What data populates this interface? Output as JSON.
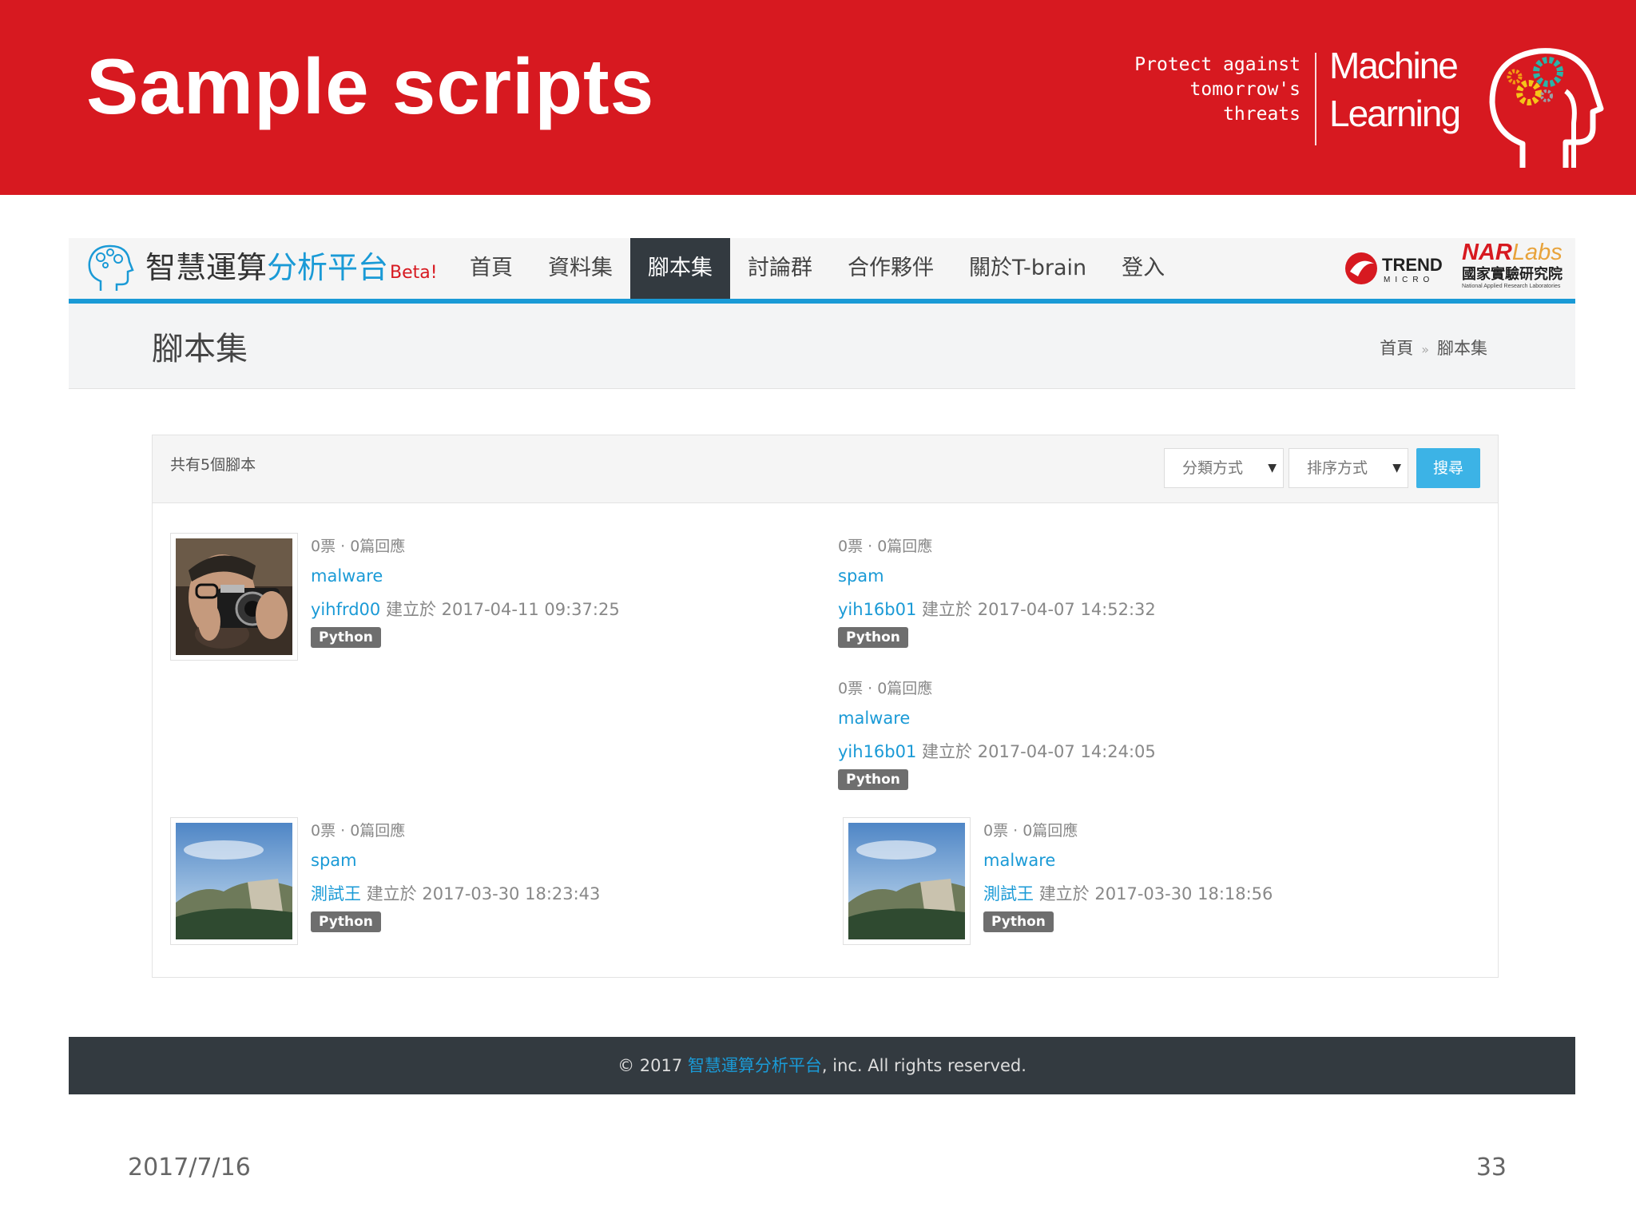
{
  "slide": {
    "title": "Sample scripts",
    "tagline": [
      "Protect against",
      "tomorrow's",
      "threats"
    ],
    "ml_label": [
      "Machine",
      "Learning"
    ],
    "date": "2017/7/16",
    "page_number": "33",
    "accent_color": "#d71920"
  },
  "site": {
    "brand": {
      "part1": "智慧運算",
      "part2": "分析平台",
      "beta": "Beta!"
    },
    "nav": [
      {
        "label": "首頁"
      },
      {
        "label": "資料集"
      },
      {
        "label": "腳本集",
        "active": true
      },
      {
        "label": "討論群"
      },
      {
        "label": "合作夥伴"
      },
      {
        "label": "關於T-brain"
      },
      {
        "label": "登入"
      }
    ],
    "partners": {
      "trend": {
        "name": "TREND",
        "sub": "MICRO"
      },
      "nar": {
        "name": "NAR",
        "labs": "Labs",
        "cn": "國家實驗研究院",
        "en": "National Applied Research Laboratories"
      }
    },
    "page_title": "腳本集",
    "breadcrumb": {
      "home": "首頁",
      "sep": "»",
      "current": "腳本集"
    },
    "list": {
      "count_text": "共有5個腳本",
      "category_select": "分類方式",
      "sort_select": "排序方式",
      "search_button": "搜尋"
    },
    "scripts": [
      {
        "votes": "0票 · 0篇回應",
        "category": "malware",
        "user": "yihfrd00",
        "created_label": "建立於",
        "created": "2017-04-11 09:37:25",
        "language": "Python"
      },
      {
        "votes": "0票 · 0篇回應",
        "category": "spam",
        "user": "yih16b01",
        "created_label": "建立於",
        "created": "2017-04-07 14:52:32",
        "language": "Python"
      },
      {
        "votes": "0票 · 0篇回應",
        "category": "malware",
        "user": "yih16b01",
        "created_label": "建立於",
        "created": "2017-04-07 14:24:05",
        "language": "Python"
      },
      {
        "votes": "0票 · 0篇回應",
        "category": "spam",
        "user": "測試王",
        "created_label": "建立於",
        "created": "2017-03-30 18:23:43",
        "language": "Python"
      },
      {
        "votes": "0票 · 0篇回應",
        "category": "malware",
        "user": "測試王",
        "created_label": "建立於",
        "created": "2017-03-30 18:18:56",
        "language": "Python"
      }
    ],
    "footer": {
      "prefix": "© 2017 ",
      "site_name": "智慧運算分析平台",
      "suffix": ", inc. All rights reserved."
    },
    "highlight_color": "#1a9ad6"
  }
}
